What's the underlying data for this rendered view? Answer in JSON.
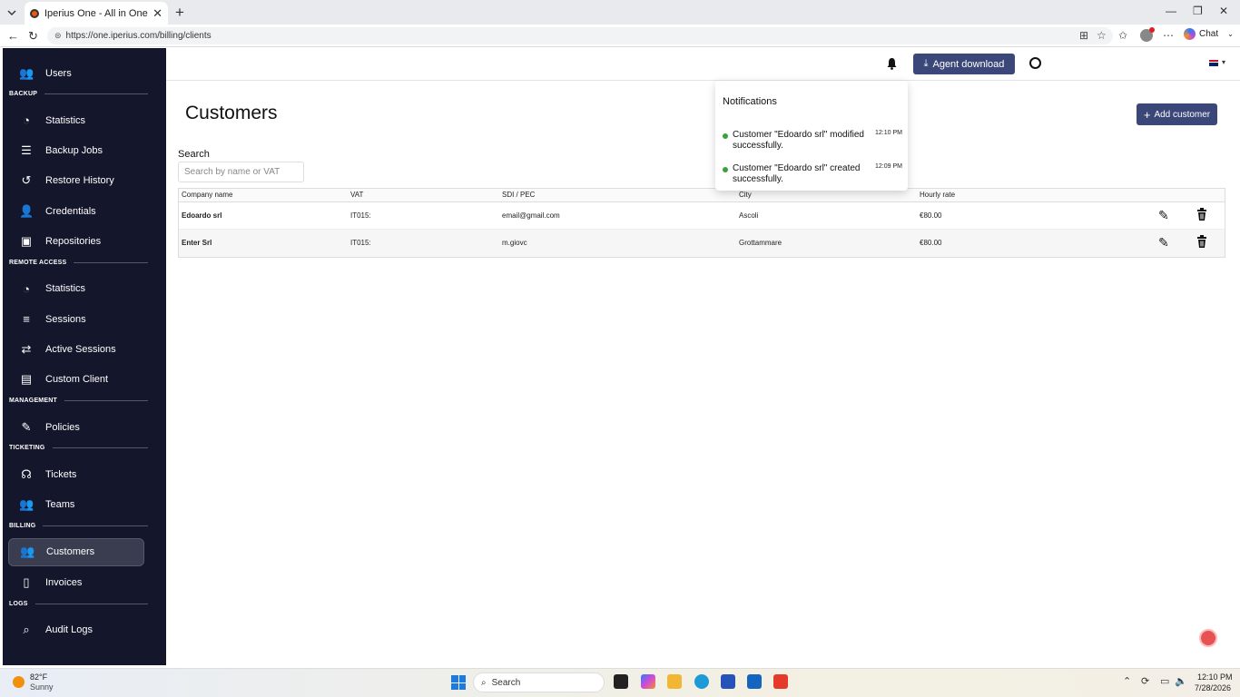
{
  "browser": {
    "tab_title": "Iperius One - All in One RMM Suite",
    "url": "https://one.iperius.com/billing/clients",
    "chat_label": "Chat"
  },
  "sidebar": {
    "top_items": [
      {
        "label": "Users",
        "icon": "users-icon"
      }
    ],
    "sections": [
      {
        "title": "BACKUP",
        "items": [
          {
            "label": "Statistics",
            "icon": "pie-chart-icon"
          },
          {
            "label": "Backup Jobs",
            "icon": "list-gear-icon"
          },
          {
            "label": "Restore History",
            "icon": "history-icon"
          },
          {
            "label": "Credentials",
            "icon": "user-lock-icon"
          },
          {
            "label": "Repositories",
            "icon": "repository-icon"
          }
        ]
      },
      {
        "title": "REMOTE ACCESS",
        "items": [
          {
            "label": "Statistics",
            "icon": "pie-chart-icon"
          },
          {
            "label": "Sessions",
            "icon": "list-icon"
          },
          {
            "label": "Active Sessions",
            "icon": "swap-icon"
          },
          {
            "label": "Custom Client",
            "icon": "window-icon"
          }
        ]
      },
      {
        "title": "MANAGEMENT",
        "items": [
          {
            "label": "Policies",
            "icon": "file-signature-icon"
          }
        ]
      },
      {
        "title": "TICKETING",
        "items": [
          {
            "label": "Tickets",
            "icon": "headset-icon"
          },
          {
            "label": "Teams",
            "icon": "team-icon"
          }
        ]
      },
      {
        "title": "BILLING",
        "items": [
          {
            "label": "Customers",
            "icon": "customers-icon",
            "active": true
          },
          {
            "label": "Invoices",
            "icon": "invoice-icon"
          }
        ]
      },
      {
        "title": "LOGS",
        "items": [
          {
            "label": "Audit Logs",
            "icon": "audit-icon"
          }
        ]
      }
    ]
  },
  "header": {
    "agent_download": "Agent download"
  },
  "page": {
    "title": "Customers",
    "add_button": "Add customer",
    "search_label": "Search",
    "search_placeholder": "Search by name or VAT"
  },
  "table": {
    "columns": [
      "Company name",
      "VAT",
      "SDI / PEC",
      "City",
      "Hourly rate"
    ],
    "rows": [
      [
        "Edoardo srl",
        "IT015:",
        "email@gmail.com",
        "Ascoli",
        "€80.00"
      ],
      [
        "Enter Srl",
        "IT015:",
        "m.giovc",
        "Grottammare",
        "€80.00"
      ]
    ]
  },
  "notifications": {
    "title": "Notifications",
    "items": [
      {
        "text": "Customer \"Edoardo srl\" modified successfully.",
        "time": "12:10 PM"
      },
      {
        "text": "Customer \"Edoardo srl\" created successfully.",
        "time": "12:09 PM"
      }
    ]
  },
  "taskbar": {
    "temp": "82°F",
    "weather": "Sunny",
    "search": "Search",
    "time": "12:10 PM",
    "date": "7/28/2026"
  },
  "colors": {
    "sidebar_bg": "#14162b",
    "primary_button": "#3b4778",
    "notification_dot": "#3aa23a"
  }
}
